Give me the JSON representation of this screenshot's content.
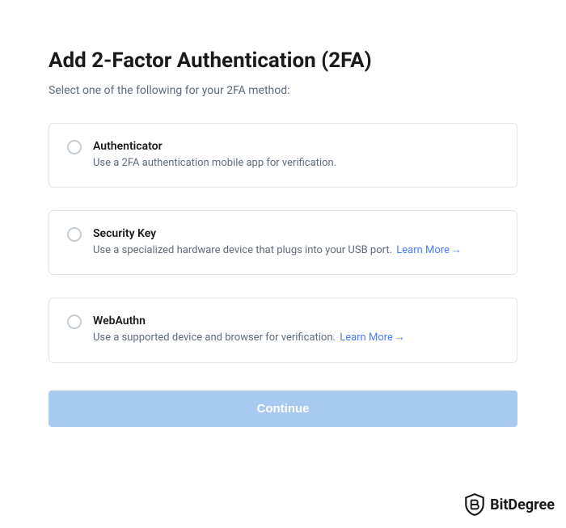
{
  "header": {
    "title": "Add 2-Factor Authentication (2FA)",
    "subtitle": "Select one of the following for your 2FA method:"
  },
  "options": [
    {
      "title": "Authenticator",
      "description": "Use a 2FA authentication mobile app for verification.",
      "learn_more": null
    },
    {
      "title": "Security Key",
      "description": "Use a specialized hardware device that plugs into your USB port.",
      "learn_more": "Learn More"
    },
    {
      "title": "WebAuthn",
      "description": "Use a supported device and browser for verification.",
      "learn_more": "Learn More"
    }
  ],
  "button": {
    "continue_label": "Continue"
  },
  "watermark": {
    "text": "BitDegree"
  }
}
